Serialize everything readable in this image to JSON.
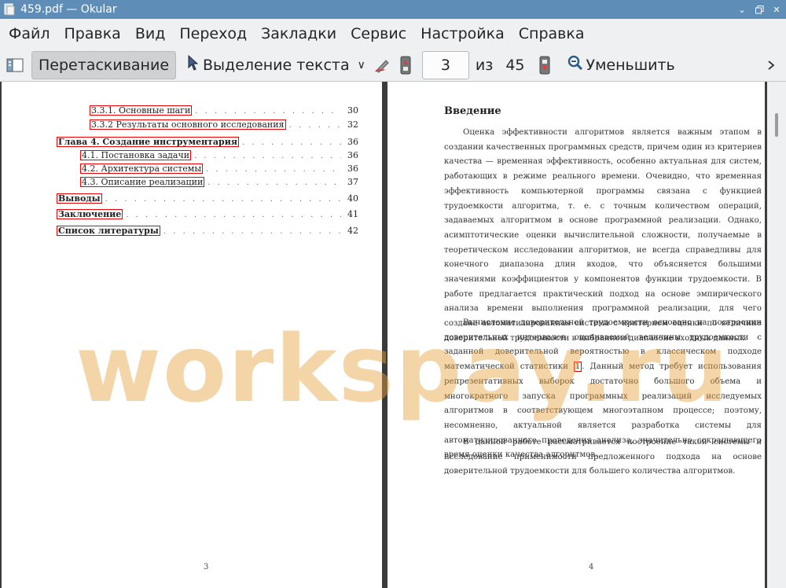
{
  "window": {
    "title": "459.pdf — Okular"
  },
  "menu": [
    "Файл",
    "Правка",
    "Вид",
    "Переход",
    "Закладки",
    "Сервис",
    "Настройка",
    "Справка"
  ],
  "toolbar": {
    "drag_label": "Перетаскивание",
    "select_label": "Выделение текста",
    "current_page": "3",
    "of_label": "из",
    "total_pages": "45",
    "zoom_out_label": "Уменьшить"
  },
  "toc": [
    {
      "label": "3.3.1.   Основные шаги",
      "page": "30",
      "bold": false
    },
    {
      "label": "3.3.2   Результаты основного исследования",
      "page": "32",
      "bold": false
    },
    {
      "label": "Глава 4. Создание инструментария",
      "page": "36",
      "bold": true
    },
    {
      "label": "4.1.   Постановка задачи",
      "page": "36",
      "bold": false
    },
    {
      "label": "4.2.   Архитектура системы",
      "page": "36",
      "bold": false
    },
    {
      "label": "4.3.   Описание реализации",
      "page": "37",
      "bold": false
    },
    {
      "label": "Выводы",
      "page": "40",
      "bold": true
    },
    {
      "label": "Заключение",
      "page": "41",
      "bold": true
    },
    {
      "label": "Список литературы",
      "page": "42",
      "bold": true
    }
  ],
  "left_page_number": "3",
  "right_page_number": "4",
  "intro": {
    "title": "Введение",
    "p1": "Оценка эффективности алгоритмов является важным этапом в создании качественных программных средств, причем один из критериев качества — временная эффективность, особенно актуальная для систем, работающих в режиме реального времени. Очевидно, что временная эффективность компьютерной программы связана с функцией трудоемкости алгоритма, т. е. с точным количеством операций, задаваемых алгоритмом в основе программной реализации. Однако, асимптотические оценки вычислительной сложности, получаемые в теоретическом исследовании алгоритмов, не всегда справедливы для конечного диапазона длин входов, что объясняется большими значениями коэффициентов у компонентов функции трудоемкости. В работе предлагается практический подход на основе эмпирического анализа времени выполнения программной реализации, для чего создана автоматизированная система с критерием оценки по величине доверительной трудоемкости в выбранном диапазоне входных данных.",
    "p2_before": "Вычисление доверительной трудоемкости основано на построении доверительных интервалов оцениваемой величины трудоемкости с заданной доверительной вероятностью в классическом подходе математической статистики ",
    "p2_cite": "1",
    "p2_after": ". Данный метод требует использования репрезентативных выборок достаточно большого объема и многократного запуска программных реализаций исследуемых алгоритмов в соответствующем многоэтапном процессе; поэтому, несомненно, актуальной является разработка системы для автоматизированного проведения анализа, значительно сокращающего время оценки качества алгоритмов.",
    "p3": "В данной работе рассматривается построение такой системы и исследование применимости предложенного подхода на основе доверительной трудоемкости для большего количества алгоритмов."
  },
  "watermark": "workspay.ru"
}
